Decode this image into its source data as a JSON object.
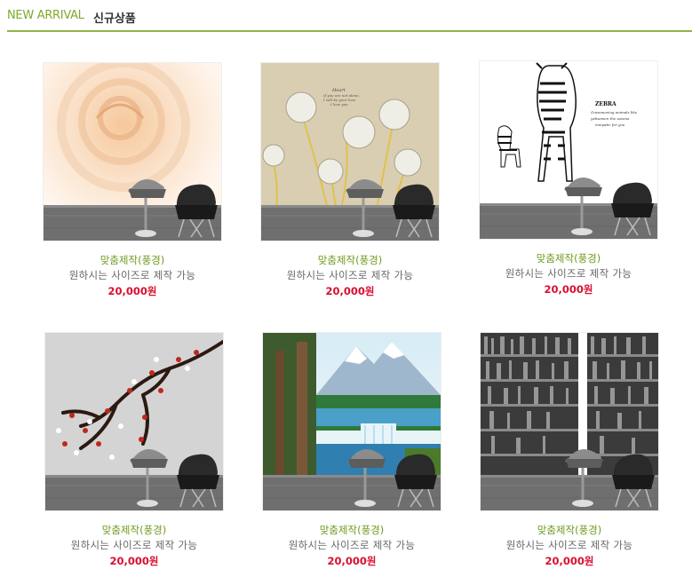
{
  "header": {
    "title_en": "NEW ARRIVAL",
    "title_ko": "신규상품"
  },
  "products": [
    {
      "category": "맞춤제작(풍경)",
      "description": "원하시는 사이즈로 제작 가능",
      "price": "20,000원",
      "image": "rose-wallpaper"
    },
    {
      "category": "맞춤제작(풍경)",
      "description": "원하시는 사이즈로 제작 가능",
      "price": "20,000원",
      "image": "dandelion-wallpaper",
      "image_text": [
        "Heart",
        "If you are not alone,",
        "I will be your love",
        "I love you"
      ]
    },
    {
      "category": "맞춤제작(풍경)",
      "description": "원하시는 사이즈로 제작 가능",
      "price": "20,000원",
      "image": "zebra-wallpaper",
      "image_text": [
        "ZEBRA",
        "Grassmoving animals like",
        "yabsamen the savana",
        "mmpatic for you"
      ]
    },
    {
      "category": "맞춤제작(풍경)",
      "description": "원하시는 사이즈로 제작 가능",
      "price": "20,000원",
      "image": "plum-blossom-wallpaper"
    },
    {
      "category": "맞춤제작(풍경)",
      "description": "원하시는 사이즈로 제작 가능",
      "price": "20,000원",
      "image": "mountain-waterfall-wallpaper"
    },
    {
      "category": "맞춤제작(풍경)",
      "description": "원하시는 사이즈로 제작 가능",
      "price": "20,000원",
      "image": "bookshelf-wallpaper"
    }
  ],
  "colors": {
    "accent_green": "#8fb446",
    "category_green": "#6d9a1d",
    "price_red": "#d80f2f",
    "text_gray": "#666666"
  }
}
